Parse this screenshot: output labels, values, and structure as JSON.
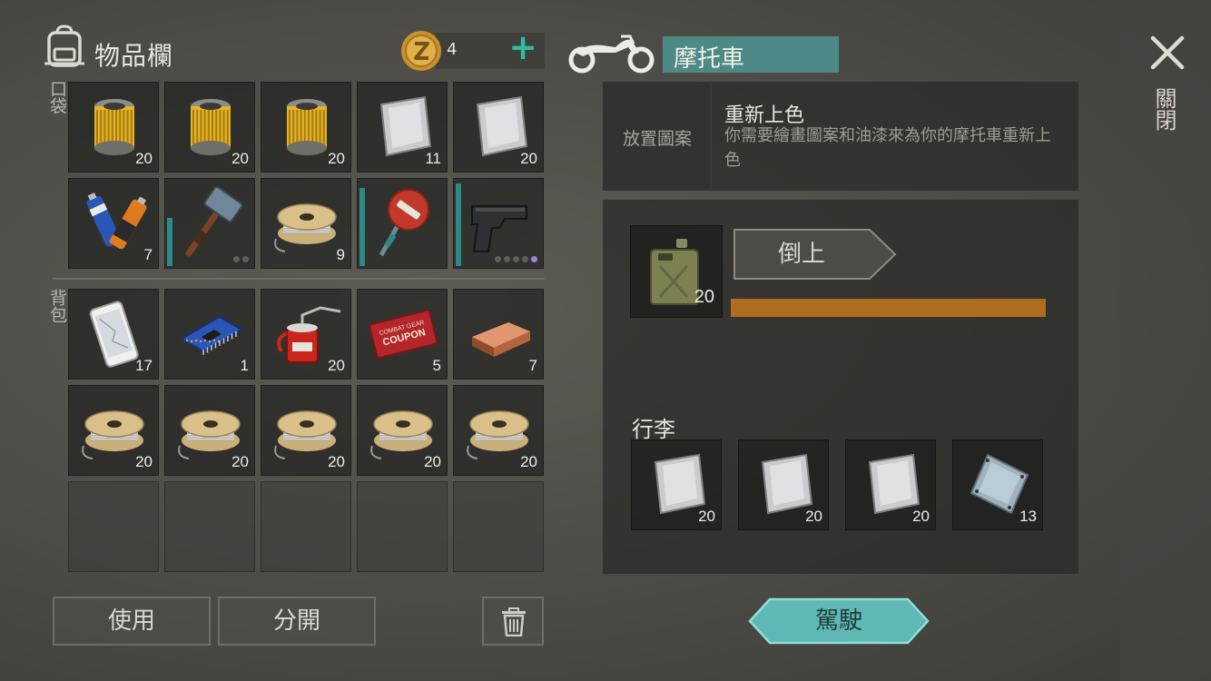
{
  "inventory": {
    "title": "物品欄",
    "coins": "4",
    "add_coin": "+",
    "pocket_label": "口袋",
    "bag_label": "背包",
    "pocket": [
      {
        "icon": "oil-filter-icon",
        "qty": "20"
      },
      {
        "icon": "oil-filter-icon",
        "qty": "20"
      },
      {
        "icon": "oil-filter-icon",
        "qty": "20"
      },
      {
        "icon": "metal-sheet-icon",
        "qty": "11"
      },
      {
        "icon": "metal-sheet-icon",
        "qty": "20"
      },
      {
        "icon": "batteries-icon",
        "qty": "7"
      },
      {
        "icon": "sledgehammer-icon",
        "qty": "",
        "durability": 0.55,
        "dots": 2,
        "dots_filled": 0
      },
      {
        "icon": "wire-spool-icon",
        "qty": "9"
      },
      {
        "icon": "stop-sign-icon",
        "qty": "",
        "durability": 0.9
      },
      {
        "icon": "pistol-icon",
        "qty": "",
        "durability": 0.95,
        "dots": 5,
        "dots_filled": 1
      }
    ],
    "backpack": [
      {
        "icon": "smartphone-icon",
        "qty": "17"
      },
      {
        "icon": "circuit-board-icon",
        "qty": "1"
      },
      {
        "icon": "oil-can-icon",
        "qty": "20"
      },
      {
        "icon": "coupon-icon",
        "qty": "5",
        "coupon_line1": "COMBAT GEAR",
        "coupon_line2": "COUPON"
      },
      {
        "icon": "copper-ingot-icon",
        "qty": "7"
      },
      {
        "icon": "wire-spool-icon",
        "qty": "20"
      },
      {
        "icon": "wire-spool-icon",
        "qty": "20"
      },
      {
        "icon": "wire-spool-icon",
        "qty": "20"
      },
      {
        "icon": "wire-spool-icon",
        "qty": "20"
      },
      {
        "icon": "wire-spool-icon",
        "qty": "20"
      },
      {
        "icon": "",
        "qty": ""
      },
      {
        "icon": "",
        "qty": ""
      },
      {
        "icon": "",
        "qty": ""
      },
      {
        "icon": "",
        "qty": ""
      },
      {
        "icon": "",
        "qty": ""
      }
    ],
    "buttons": {
      "use": "使用",
      "split": "分開"
    }
  },
  "vehicle": {
    "name": "摩托車",
    "paint": {
      "slot_label": "放置圖案",
      "title": "重新上色",
      "description": "你需要繪畫圖案和油漆來為你的摩托車重新上色"
    },
    "fuel": {
      "qty": "20",
      "pour_label": "倒上",
      "level": 1.0
    },
    "trunk_label": "行李",
    "trunk": [
      {
        "icon": "metal-sheet-icon",
        "qty": "20"
      },
      {
        "icon": "metal-sheet-icon",
        "qty": "20"
      },
      {
        "icon": "metal-sheet-icon",
        "qty": "20"
      },
      {
        "icon": "steel-plate-icon",
        "qty": "13"
      }
    ],
    "drive_label": "駕駛"
  },
  "close_label": "關閉",
  "colors": {
    "accent_teal": "#4d8a87",
    "plus_green": "#2dbda0",
    "fuel_orange": "#b06d20",
    "drive_button": "#5fb8b3",
    "rare_dot": "#a67be0"
  }
}
